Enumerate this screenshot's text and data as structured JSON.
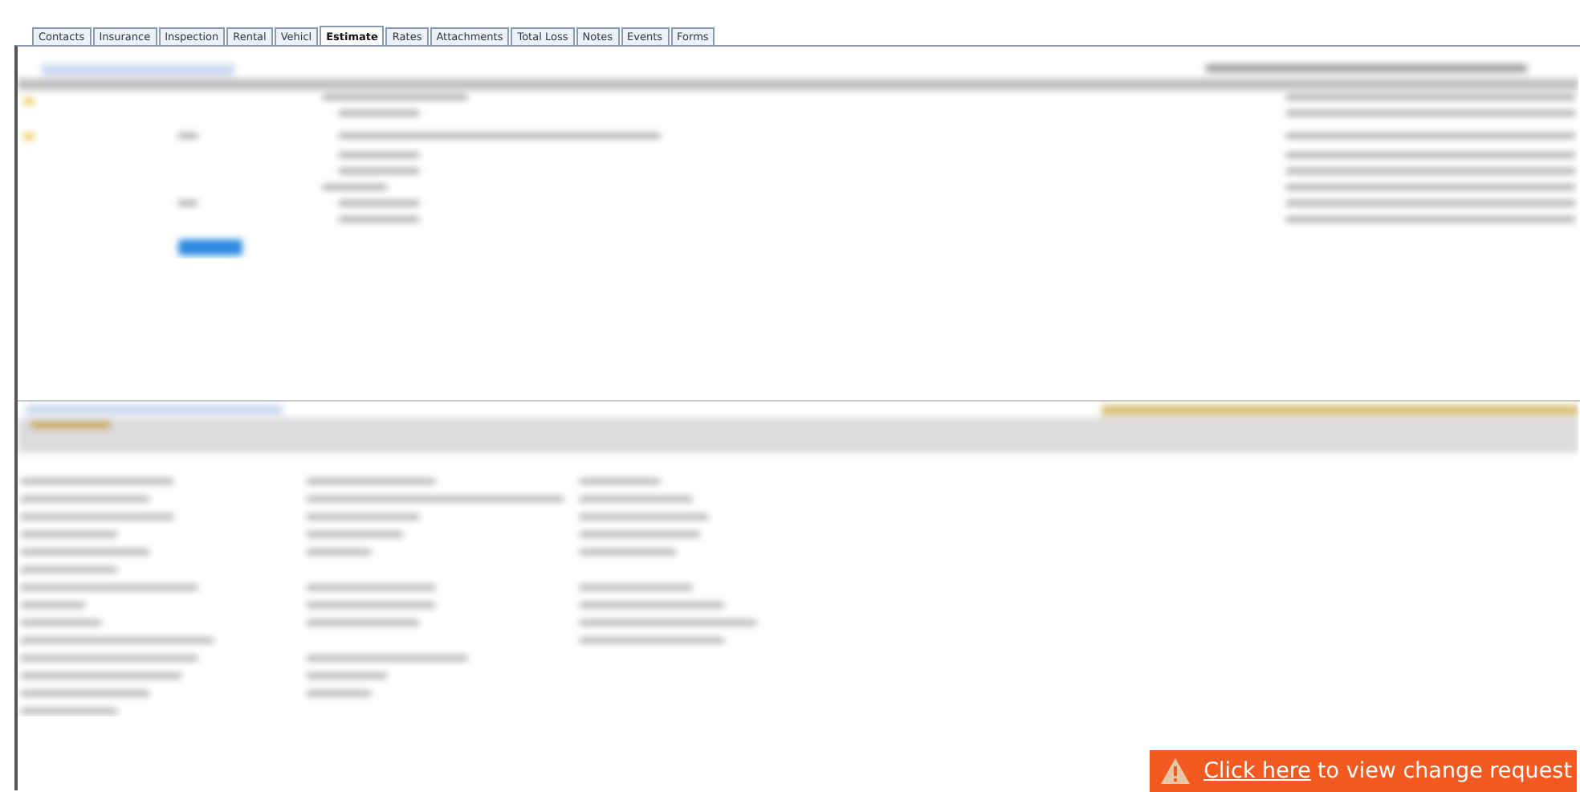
{
  "tabs": [
    {
      "label": "Contacts",
      "selected": false
    },
    {
      "label": "Insurance",
      "selected": false
    },
    {
      "label": "Inspection",
      "selected": false
    },
    {
      "label": "Rental",
      "selected": false
    },
    {
      "label": "Vehicl",
      "selected": false
    },
    {
      "label": "Estimate",
      "selected": true
    },
    {
      "label": "Rates",
      "selected": false
    },
    {
      "label": "Attachments",
      "selected": false
    },
    {
      "label": "Total Loss",
      "selected": false
    },
    {
      "label": "Notes",
      "selected": false
    },
    {
      "label": "Events",
      "selected": false
    },
    {
      "label": "Forms",
      "selected": false
    }
  ],
  "banner": {
    "link": "Click here",
    "text": "to view change request"
  }
}
